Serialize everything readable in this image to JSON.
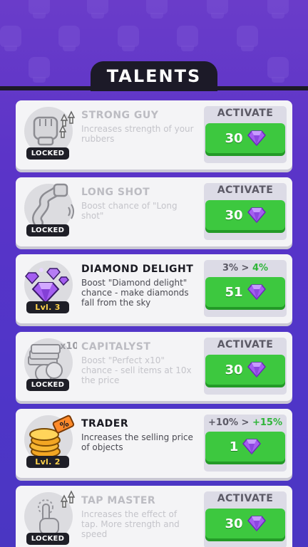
{
  "header": {
    "title": "TALENTS"
  },
  "talents": [
    {
      "name": "STRONG GUY",
      "desc": "Increases strength of your rubbers",
      "badge": "LOCKED",
      "action": "ACTIVATE",
      "cost": "30",
      "icon": "fist-icon"
    },
    {
      "name": "LONG SHOT",
      "desc": "Boost chance of \"Long shot\"",
      "badge": "LOCKED",
      "action": "ACTIVATE",
      "cost": "30",
      "icon": "stretched-arm-icon"
    },
    {
      "name": "DIAMOND DELIGHT",
      "desc": "Boost \"Diamond delight\" chance - make diamonds fall from the sky",
      "badge": "Lvl. 3",
      "current": "3%",
      "arrow": ">",
      "next": "4%",
      "cost": "51",
      "icon": "diamonds-icon"
    },
    {
      "name": "CAPITALYST",
      "desc": "Boost \"Perfect x10\" chance - sell items at 10x the price",
      "badge": "LOCKED",
      "action": "ACTIVATE",
      "cost": "30",
      "icon": "money-stack-x10-icon",
      "icon_text": "x10"
    },
    {
      "name": "TRADER",
      "desc": "Increases the selling price of objects",
      "badge": "Lvl. 2",
      "current": "+10%",
      "arrow": ">",
      "next": "+15%",
      "cost": "1",
      "icon": "coins-price-tag-icon",
      "icon_text": "%"
    },
    {
      "name": "TAP MASTER",
      "desc": "Increases the effect of tap. More strength and speed",
      "badge": "LOCKED",
      "action": "ACTIVATE",
      "cost": "30",
      "icon": "tap-hand-icon"
    }
  ],
  "colors": {
    "background": "#5b34c8",
    "button": "#3dc83f",
    "gem": "#a45ef0",
    "badge": "#1f1f27"
  }
}
